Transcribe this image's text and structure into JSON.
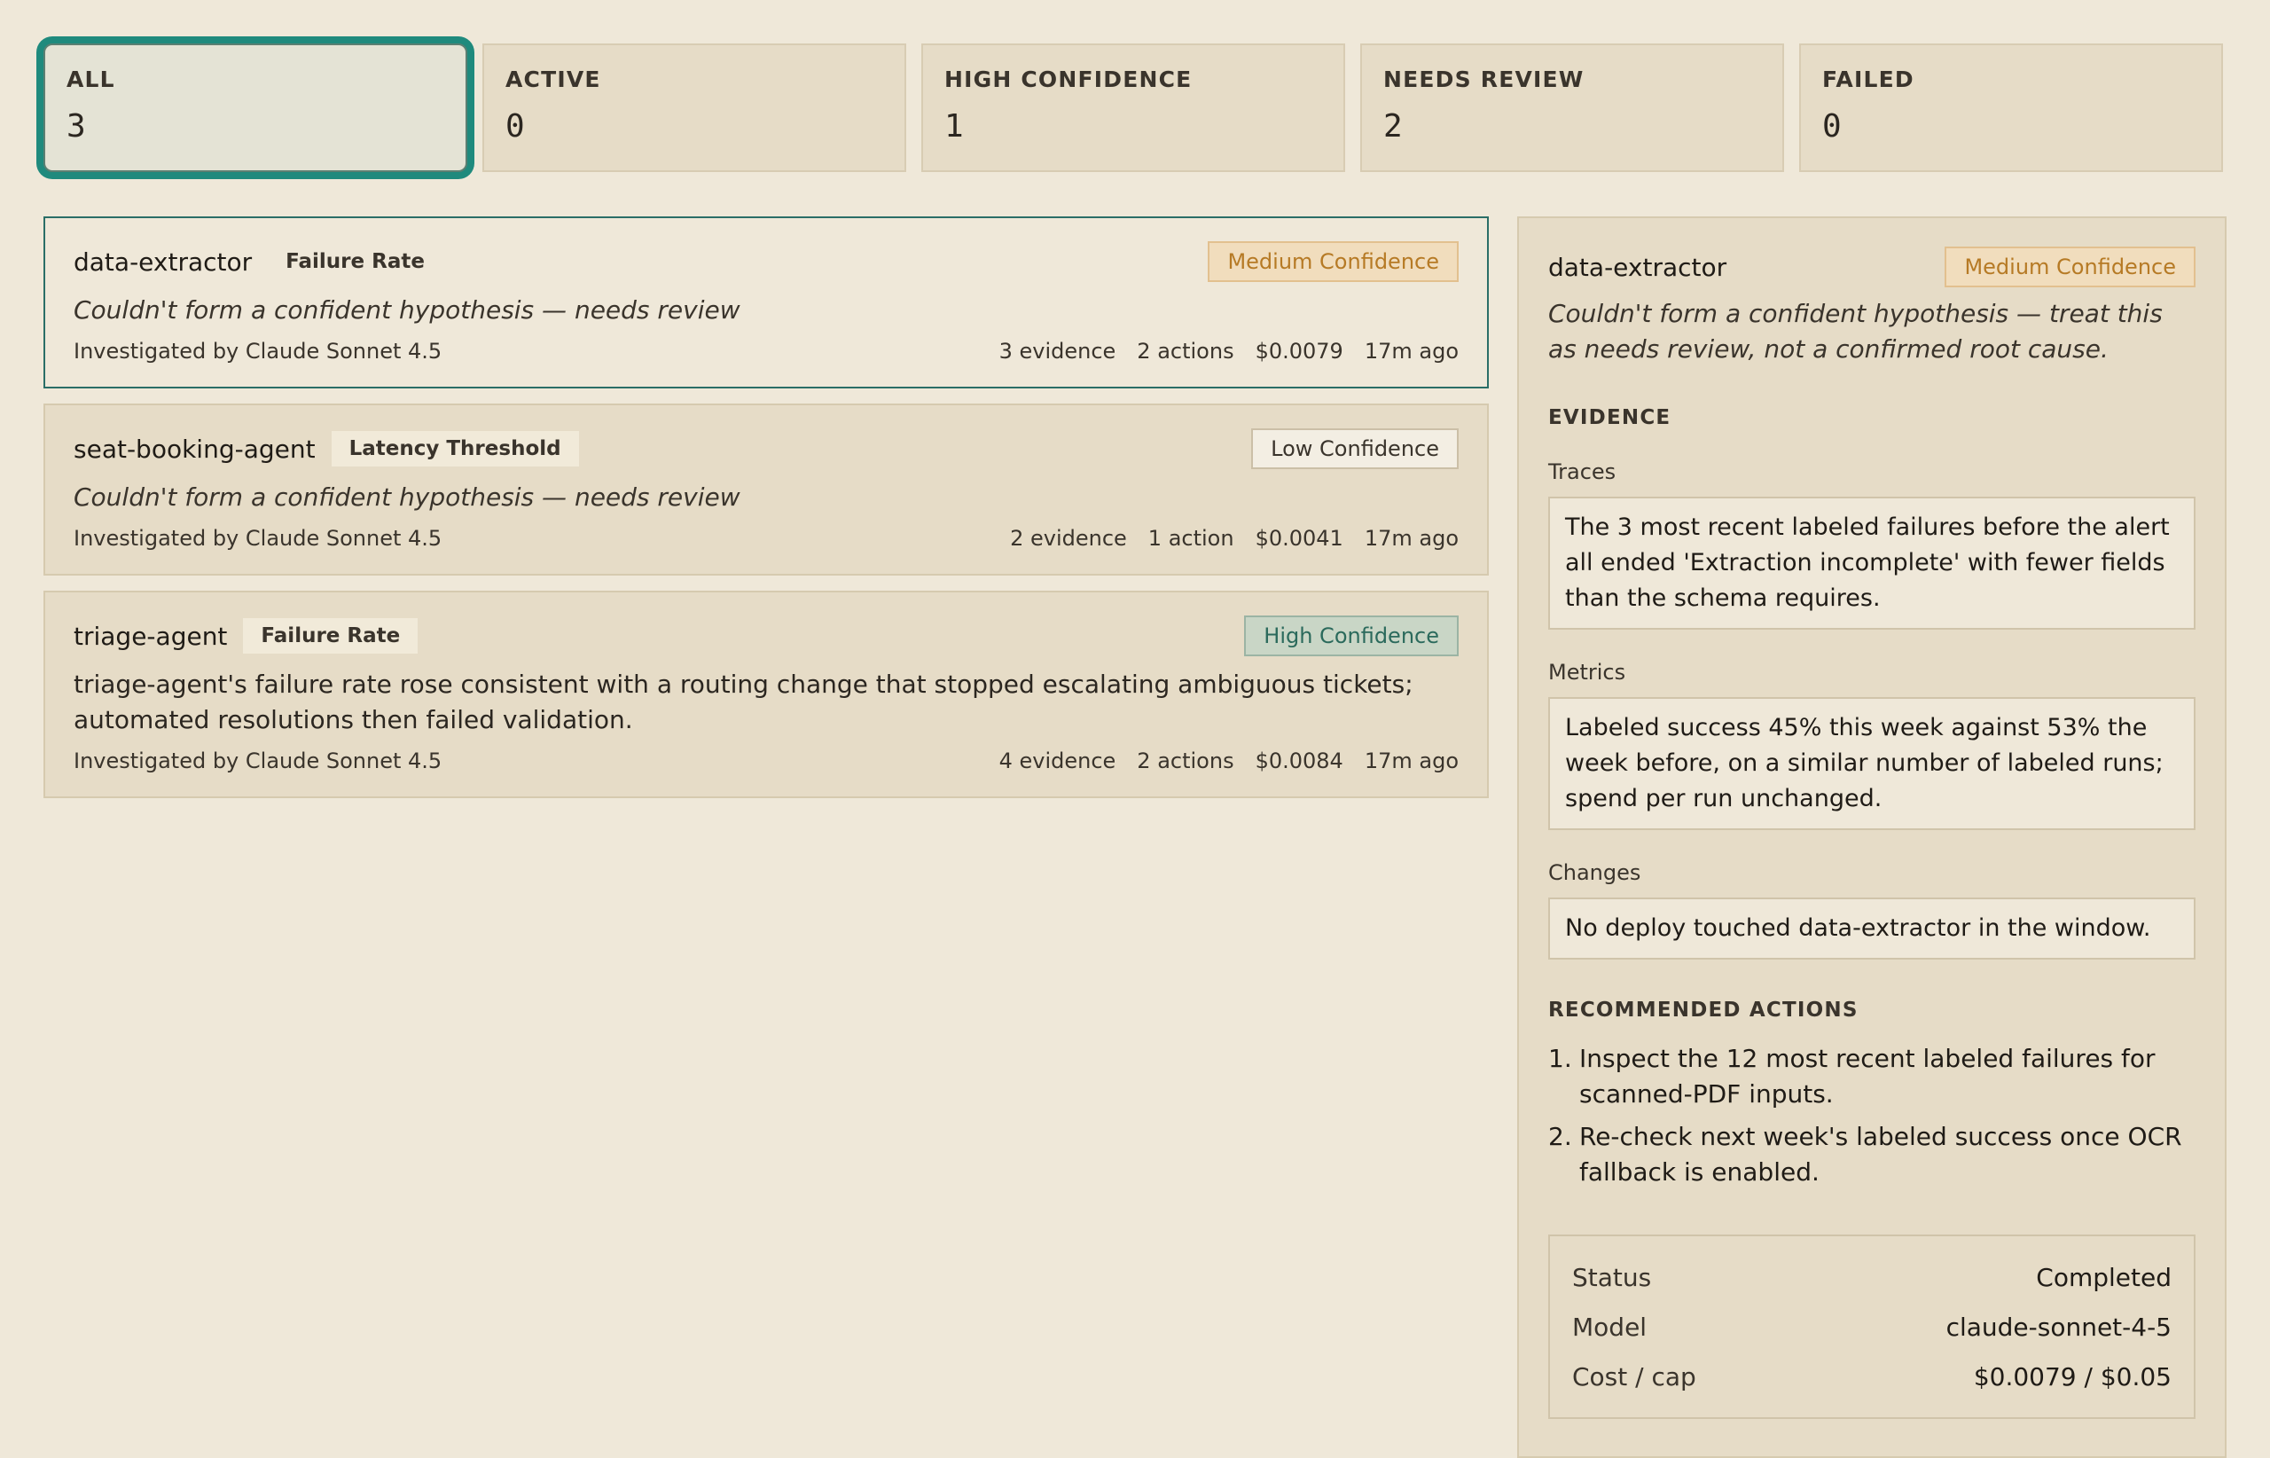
{
  "filters": [
    {
      "label": "ALL",
      "count": "3"
    },
    {
      "label": "ACTIVE",
      "count": "0"
    },
    {
      "label": "HIGH CONFIDENCE",
      "count": "1"
    },
    {
      "label": "NEEDS REVIEW",
      "count": "2"
    },
    {
      "label": "FAILED",
      "count": "0"
    }
  ],
  "incidents": [
    {
      "agent": "data-extractor",
      "type": "Failure Rate",
      "confidence": "Medium Confidence",
      "summary": "Couldn't form a confident hypothesis — needs review",
      "investigator": "Investigated by Claude Sonnet 4.5",
      "evidence": "3 evidence",
      "actions": "2 actions",
      "cost": "$0.0079",
      "age": "17m ago"
    },
    {
      "agent": "seat-booking-agent",
      "type": "Latency Threshold",
      "confidence": "Low Confidence",
      "summary": "Couldn't form a confident hypothesis — needs review",
      "investigator": "Investigated by Claude Sonnet 4.5",
      "evidence": "2 evidence",
      "actions": "1 action",
      "cost": "$0.0041",
      "age": "17m ago"
    },
    {
      "agent": "triage-agent",
      "type": "Failure Rate",
      "confidence": "High Confidence",
      "summary": "triage-agent's failure rate rose consistent with a routing change that stopped escalating ambiguous tickets; automated resolutions then failed validation.",
      "investigator": "Investigated by Claude Sonnet 4.5",
      "evidence": "4 evidence",
      "actions": "2 actions",
      "cost": "$0.0084",
      "age": "17m ago"
    }
  ],
  "detail": {
    "agent": "data-extractor",
    "confidence": "Medium Confidence",
    "summary": "Couldn't form a confident hypothesis — treat this as needs review, not a confirmed root cause.",
    "evidence_title": "EVIDENCE",
    "evidence": [
      {
        "label": "Traces",
        "text": "The 3 most recent labeled failures before the alert all ended 'Extraction incomplete' with fewer fields than the schema requires."
      },
      {
        "label": "Metrics",
        "text": "Labeled success 45% this week against 53% the week before, on a similar number of labeled runs; spend per run unchanged."
      },
      {
        "label": "Changes",
        "text": "No deploy touched data-extractor in the window."
      }
    ],
    "actions_title": "RECOMMENDED ACTIONS",
    "actions": [
      {
        "num": "1.",
        "text": "Inspect the 12 most recent labeled failures for scanned-PDF inputs."
      },
      {
        "num": "2.",
        "text": "Re-check next week's labeled success once OCR fallback is enabled."
      }
    ],
    "status": [
      {
        "key": "Status",
        "value": "Completed"
      },
      {
        "key": "Model",
        "value": "claude-sonnet-4-5"
      },
      {
        "key": "Cost / cap",
        "value": "$0.0079 / $0.05"
      }
    ]
  }
}
